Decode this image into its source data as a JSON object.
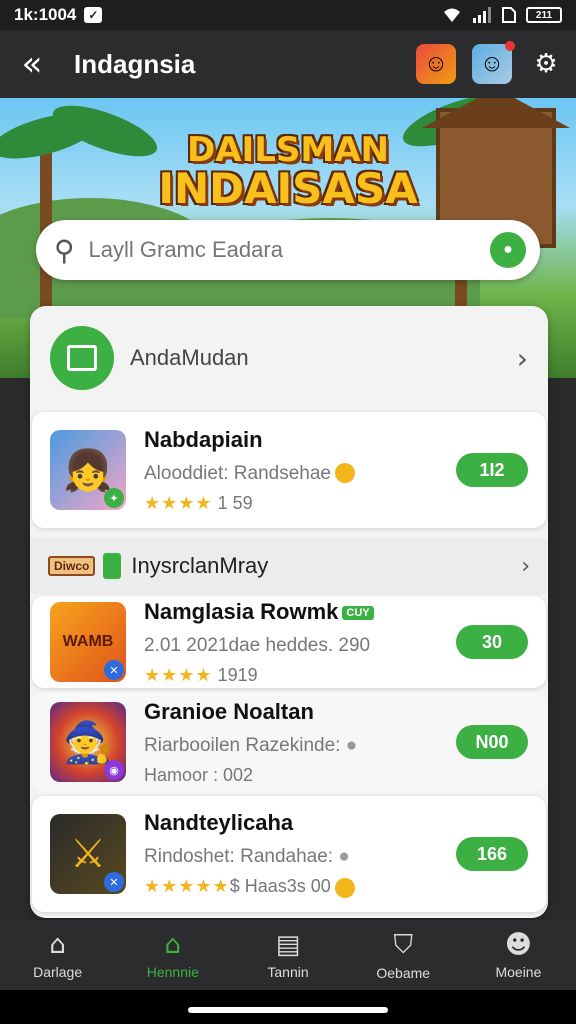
{
  "status_bar": {
    "time": "1k:1004",
    "battery": "211"
  },
  "app_bar": {
    "title": "Indagnsia"
  },
  "banner": {
    "logo_line1": "DAILSMAN",
    "logo_line2": "INDAISASA"
  },
  "search": {
    "placeholder": "Layll Gramc Eadara"
  },
  "category": {
    "label": "AndaMudan"
  },
  "featured": {
    "title": "Nabdapiain",
    "subtitle": "Alooddiet: Randsehae",
    "stars": "★★★★",
    "rating": "1 59",
    "price": "1I2"
  },
  "section": {
    "chip": "Diwco",
    "label": "InysrclanMray"
  },
  "games": [
    {
      "title": "Namglasia Rowmk",
      "tag": "CUY",
      "subtitle": "2.01 2021dae heddes. 290",
      "stars": "★★★★",
      "meta": "1919",
      "price": "30"
    },
    {
      "title": "Granioe Noaltan",
      "subtitle": "Riarbooilen Razekinde:",
      "meta": "Hamoor : 002",
      "price": "N00"
    },
    {
      "title": "Nandteylicaha",
      "subtitle": "Rindoshet: Randahae:",
      "stars": "★★★★★",
      "meta": "$ Haas3s 00",
      "price": "166"
    }
  ],
  "nav": [
    {
      "label": "Darlage",
      "icon": "home-icon"
    },
    {
      "label": "Hennnie",
      "icon": "store-icon"
    },
    {
      "label": "Tannin",
      "icon": "clipboard-icon"
    },
    {
      "label": "Oebame",
      "icon": "shield-icon"
    },
    {
      "label": "Moeine",
      "icon": "profile-icon"
    }
  ],
  "colors": {
    "accent": "#3cb043",
    "background": "#2a2a2c",
    "star": "#f2b51c"
  }
}
